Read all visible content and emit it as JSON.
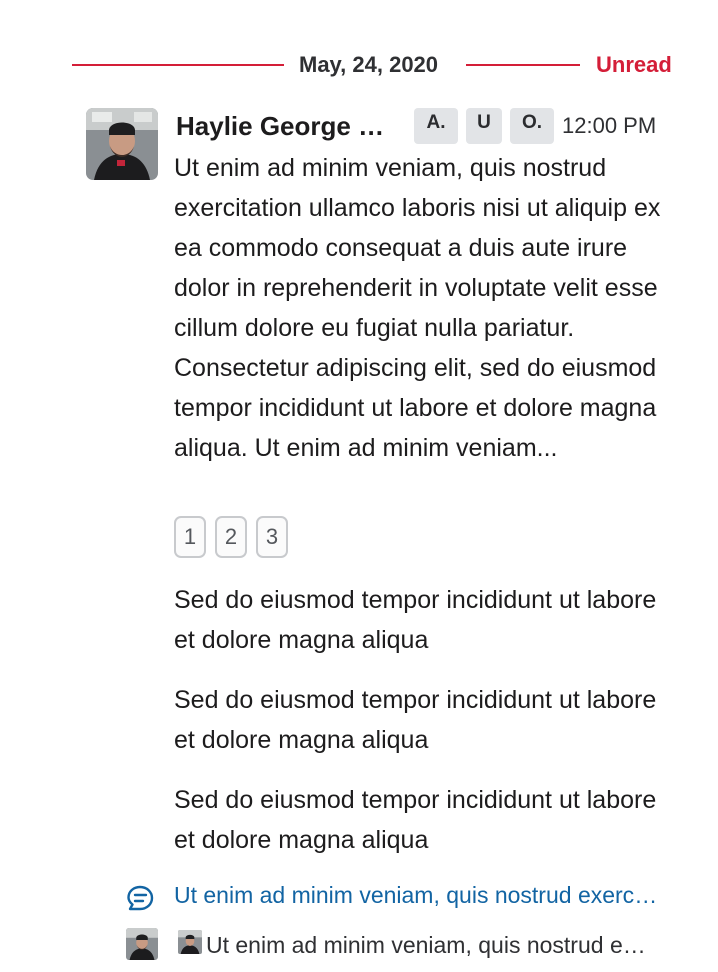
{
  "divider": {
    "date": "May, 24, 2020",
    "unread_label": "Unread"
  },
  "message": {
    "author": "Haylie George Lorem Ipsum",
    "badges": [
      "A.",
      "U",
      "O."
    ],
    "time": "12:00 PM",
    "body": "Ut enim ad minim veniam, quis nostrud exercitation ullamco laboris nisi ut aliquip ex ea commodo consequat a duis aute irure dolor in reprehenderit in voluptate velit esse cillum dolore eu fugiat nulla pariatur. Consectetur adipiscing elit, sed do eiusmod tempor incididunt ut labore et dolore magna aliqua. Ut enim ad minim veniam...",
    "reactions": [
      "1",
      "2",
      "3"
    ]
  },
  "followups": [
    "Sed do eiusmod tempor incididunt ut labore et dolore magna aliqua",
    "Sed do eiusmod tempor incididunt ut labore et dolore magna aliqua",
    "Sed do eiusmod tempor incididunt ut labore et dolore magna aliqua"
  ],
  "thread": {
    "icon": "thread-reply-icon",
    "preview": "Ut enim ad minim veniam, quis nostrud exercitation ullamco laboris"
  },
  "reply": {
    "preview": "Ut enim ad minim veniam, quis nostrud exercitation ullamco"
  },
  "colors": {
    "accent_red": "#d41e38",
    "link_blue": "#1264a3",
    "badge_bg": "#e2e4e7"
  }
}
